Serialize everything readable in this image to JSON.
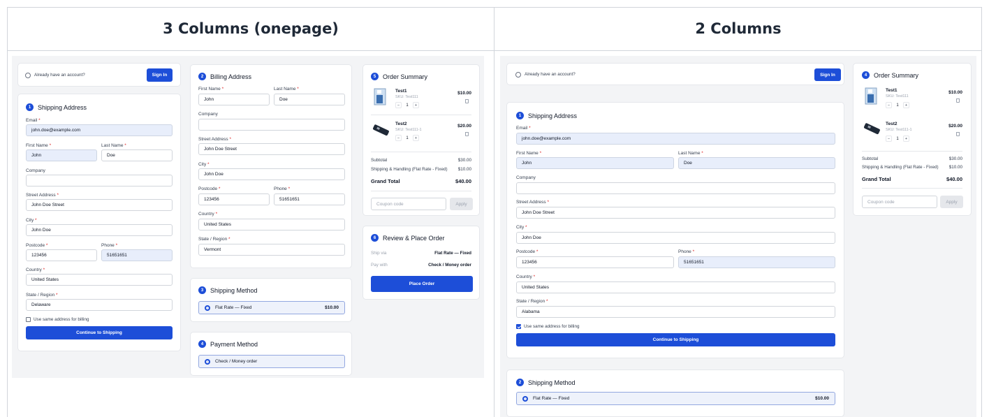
{
  "titles": {
    "left": "3 Columns (onepage)",
    "right": "2 Columns"
  },
  "account": {
    "text": "Already have an account?",
    "sign_in": "Sign In"
  },
  "shipping": {
    "step": "1",
    "title": "Shipping Address",
    "email_label": "Email",
    "email": "john.doe@example.com",
    "first_label": "First Name",
    "first": "John",
    "last_label": "Last Name",
    "last": "Doe",
    "company_label": "Company",
    "company": "",
    "street_label": "Street Address",
    "street": "John Doe Street",
    "city_label": "City",
    "city": "John Doe",
    "postcode_label": "Postcode",
    "postcode": "123456",
    "phone_label": "Phone",
    "phone": "51651651",
    "country_label": "Country",
    "country": "United States",
    "region_label": "State / Region",
    "region_left": "Delaware",
    "region_right": "Alabama",
    "same_billing": "Use same address for billing",
    "continue": "Continue to Shipping"
  },
  "billing": {
    "step": "2",
    "title": "Billing Address",
    "first": "John",
    "last": "Doe",
    "street": "John Doe Street",
    "city": "John Doe",
    "postcode": "123456",
    "phone": "51651651",
    "country": "United States",
    "region": "Vermont"
  },
  "shipping_method": {
    "step_left": "3",
    "step_right": "2",
    "title": "Shipping Method",
    "option": "Flat Rate — Fixed",
    "price": "$10.00"
  },
  "payment": {
    "step": "4",
    "title": "Payment Method",
    "option": "Check / Money order"
  },
  "summary": {
    "step_left": "5",
    "step_right": "4",
    "title": "Order Summary",
    "items": [
      {
        "name": "Test1",
        "sku": "SKU: Test111",
        "qty": "1",
        "price": "$10.00"
      },
      {
        "name": "Test2",
        "sku": "SKU: Test111-1",
        "qty": "1",
        "price": "$20.00"
      }
    ],
    "subtotal_label": "Subtotal",
    "subtotal": "$30.00",
    "shipping_label": "Shipping & Handling (Flat Rate - Fixed)",
    "shipping": "$10.00",
    "grand_label": "Grand Total",
    "grand": "$40.00",
    "coupon_placeholder": "Coupon code",
    "apply": "Apply",
    "minus": "−",
    "plus": "+"
  },
  "review": {
    "step": "6",
    "title": "Review & Place Order",
    "ship_via_label": "Ship via",
    "ship_via": "Flat Rate — Fixed",
    "pay_with_label": "Pay with",
    "pay_with": "Check / Money order",
    "place": "Place Order"
  },
  "required_mark": "*"
}
